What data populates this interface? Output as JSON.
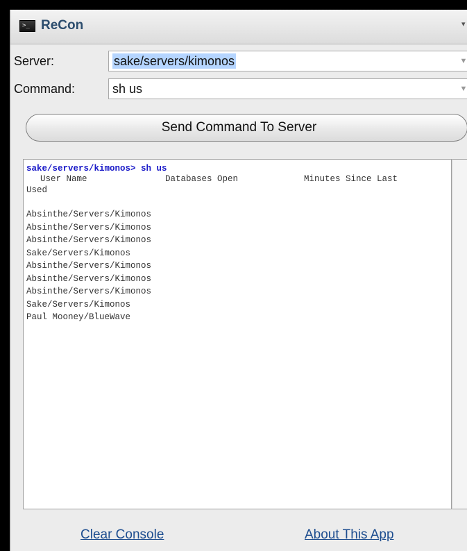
{
  "window": {
    "app_icon_glyph": ">_",
    "title": "ReCon",
    "menu_glyph": "▾"
  },
  "form": {
    "server_label": "Server:",
    "server_value": "sake/servers/kimonos",
    "command_label": "Command:",
    "command_value": "sh us",
    "combo_arrow": "▼"
  },
  "send_button_label": "Send Command To Server",
  "console": {
    "prompt": "sake/servers/kimonos> sh us",
    "headers": [
      "User Name",
      "Databases Open",
      "Minutes Since Last"
    ],
    "header_continuation": "Used",
    "users": [
      "Absinthe/Servers/Kimonos",
      "Absinthe/Servers/Kimonos",
      "Absinthe/Servers/Kimonos",
      "Sake/Servers/Kimonos",
      "Absinthe/Servers/Kimonos",
      "Absinthe/Servers/Kimonos",
      "Absinthe/Servers/Kimonos",
      "Sake/Servers/Kimonos",
      "Paul Mooney/BlueWave"
    ]
  },
  "footer": {
    "clear_console": "Clear Console",
    "about_app": "About This App"
  }
}
